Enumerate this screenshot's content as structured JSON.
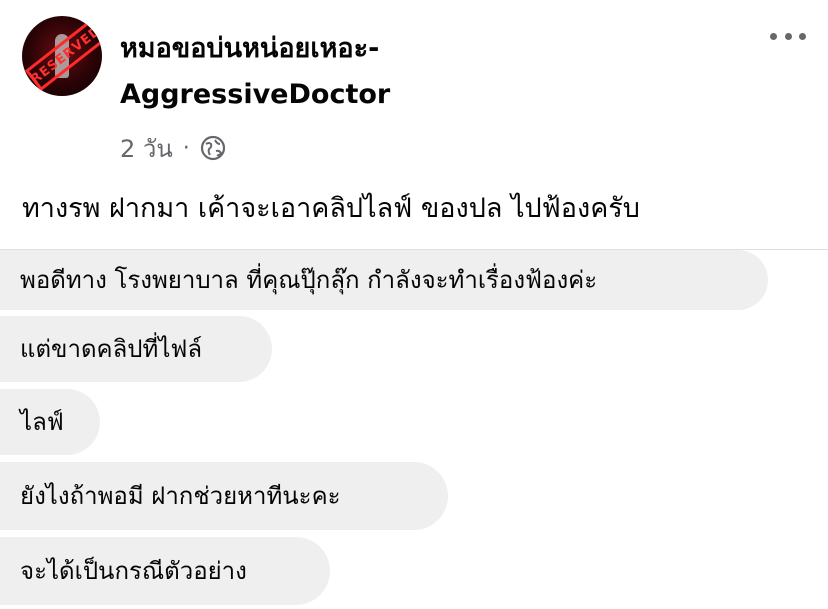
{
  "post": {
    "avatar_stamp": "RESERVED",
    "author_line1": "หมอขอบ่นหน่อยเหอะ-",
    "author_line2": "AggressiveDoctor",
    "time": "2 วัน",
    "separator": "·",
    "privacy_icon": "globe-icon",
    "more_icon": "more-options-icon",
    "text": "ทางรพ ฝากมา เค้าจะเอาคลิปไลฟ์ ของปล ไปฟ้องครับ"
  },
  "messages": [
    "พอดีทาง โรงพยาบาล ที่คุณปุ๊กลุ๊ก กำลังจะทำเรื่องฟ้องค่ะ",
    "แต่ขาดคลิปที่ไฟล์",
    "ไลฟ์",
    "ยังไงถ้าพอมี ฝากช่วยหาทีนะคะ",
    "จะได้เป็นกรณีตัวอย่าง"
  ],
  "colors": {
    "bubble_bg": "#efefef",
    "meta_text": "#65676b",
    "stamp_red": "#ff2a2a"
  }
}
